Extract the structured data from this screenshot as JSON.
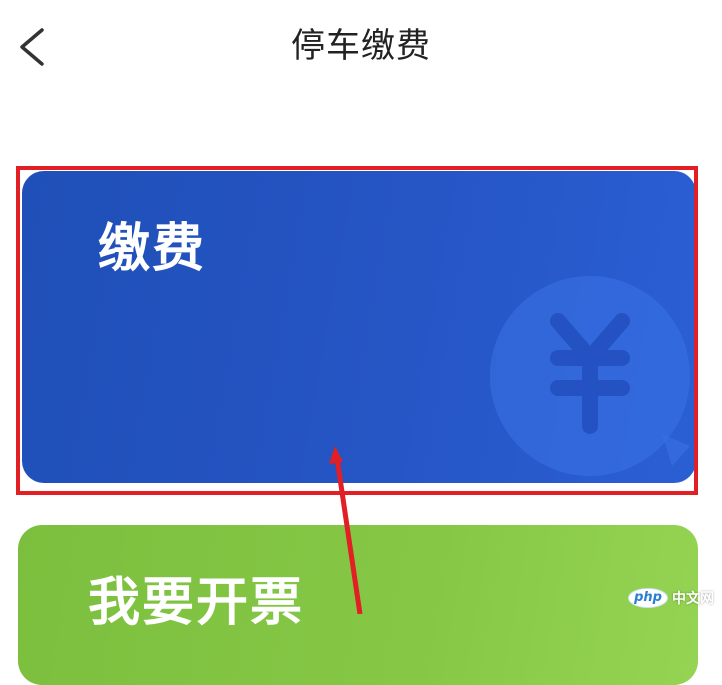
{
  "header": {
    "title": "停车缴费",
    "back_icon": "chevron-left-icon"
  },
  "cards": [
    {
      "label": "缴费",
      "color_start": "#1f4fb7",
      "color_end": "#2a5fd4",
      "icon": "yuan-coin-icon",
      "highlighted": true
    },
    {
      "label": "我要开票",
      "color_start": "#7cbf3e",
      "color_end": "#95d452"
    }
  ],
  "annotation": {
    "box_color": "#e11f25",
    "arrow_color": "#e11f25"
  },
  "watermark": {
    "logo": "php",
    "text": "中文网"
  }
}
